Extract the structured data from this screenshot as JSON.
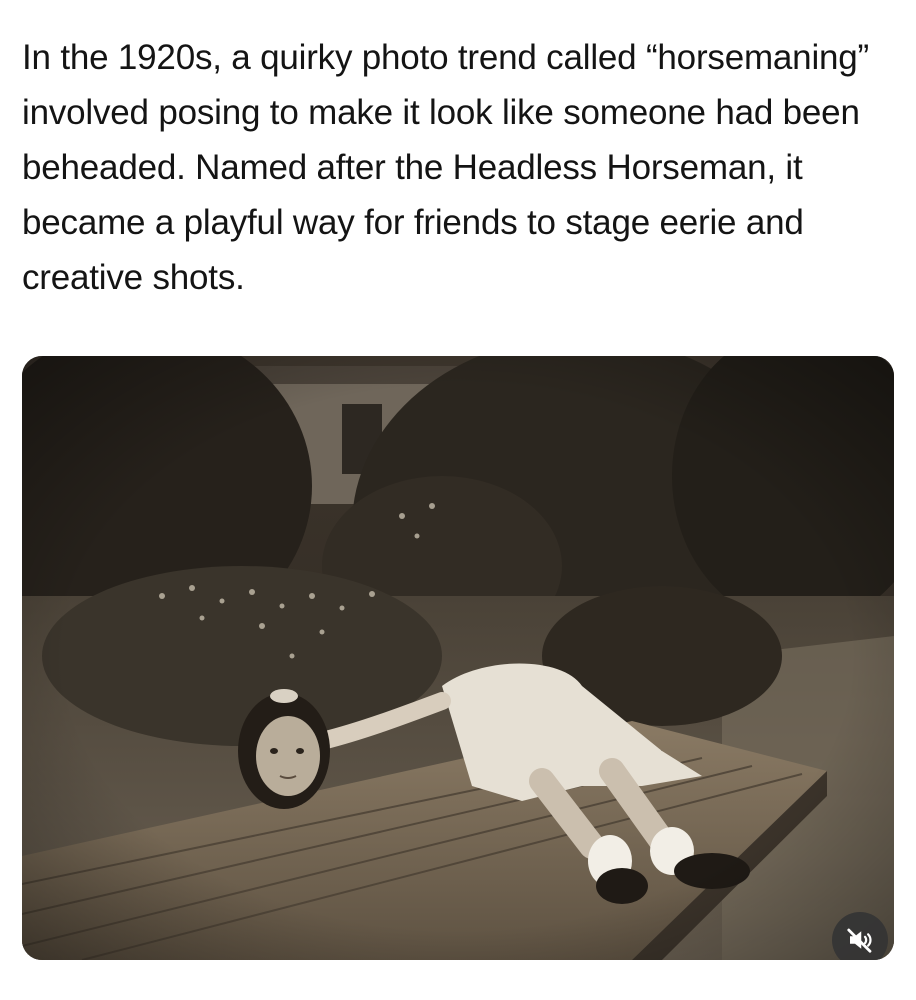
{
  "post": {
    "caption": "In the 1920s, a quirky photo trend called “horsemaning” involved posing to make it look like someone had been beheaded. Named after the Headless Horseman, it became a playful way for friends to stage eerie and creative shots."
  },
  "media": {
    "type": "video",
    "description_icon": "sepia-photo",
    "audio_state": "muted",
    "mute_icon": "speaker-muted-icon"
  }
}
